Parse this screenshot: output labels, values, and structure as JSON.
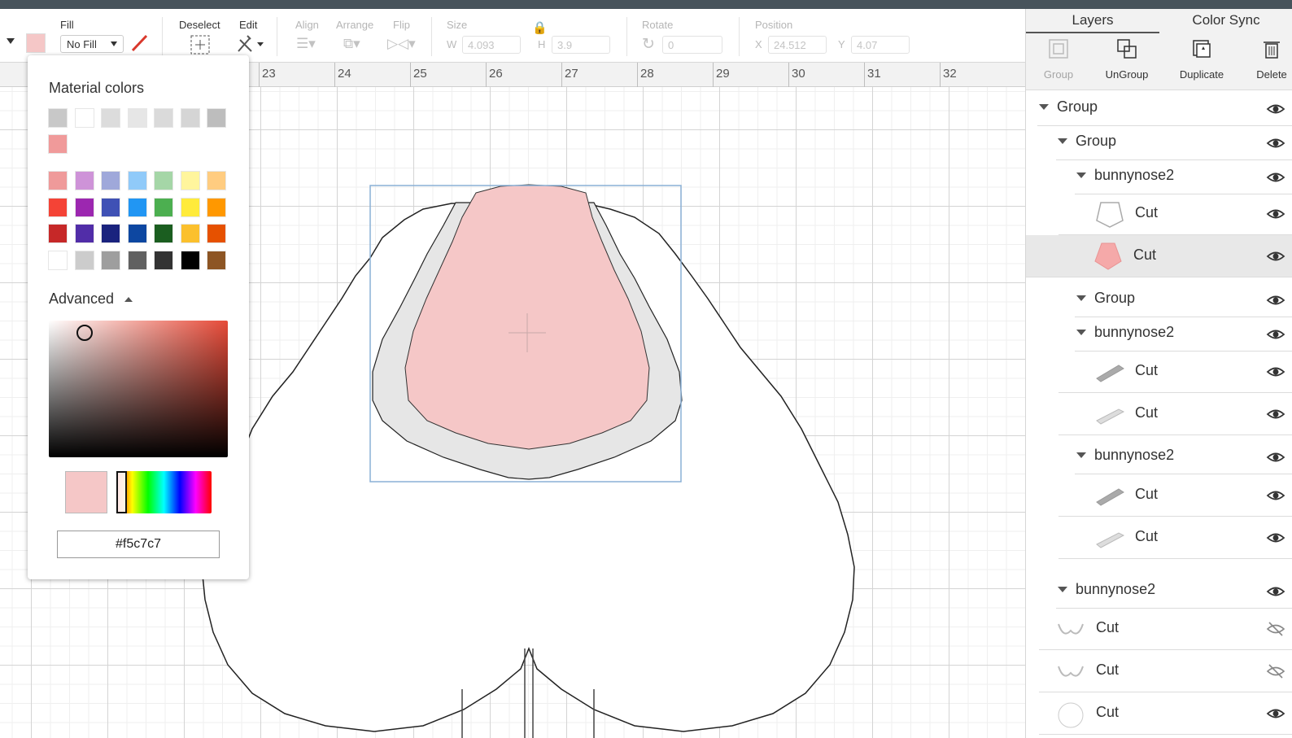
{
  "toolbar": {
    "fill_label": "Fill",
    "fill_value": "No Fill",
    "deselect_label": "Deselect",
    "edit_label": "Edit",
    "align_label": "Align",
    "arrange_label": "Arrange",
    "flip_label": "Flip",
    "size_label": "Size",
    "w_label": "W",
    "w_value": "4.093",
    "h_label": "H",
    "h_value": "3.9",
    "rotate_label": "Rotate",
    "rotate_value": "0",
    "position_label": "Position",
    "x_label": "X",
    "x_value": "24.512",
    "y_label": "Y",
    "y_value": "4.07",
    "swatch_color": "#f5c7c7",
    "stroke_color": "#d9382c"
  },
  "ruler": {
    "numbers": [
      "23",
      "24",
      "25",
      "26",
      "27",
      "28",
      "29",
      "30",
      "31",
      "32"
    ]
  },
  "color_popup": {
    "title": "Material colors",
    "row_grey": [
      "#c8c8c8",
      "#ffffff",
      "#dcdcdc",
      "#e6e6e6",
      "#dadada",
      "#d5d5d5",
      "#bdbdbd"
    ],
    "row_pink": [
      "#f09a9a"
    ],
    "palette": [
      [
        "#ef9a9a",
        "#ce93d8",
        "#9fa8da",
        "#90caf9",
        "#a5d6a7",
        "#fff59d",
        "#ffcc80"
      ],
      [
        "#f44336",
        "#9c27b0",
        "#3f51b5",
        "#2196f3",
        "#4caf50",
        "#ffeb3b",
        "#ff9800"
      ],
      [
        "#c62828",
        "#512da8",
        "#1a237e",
        "#0d47a1",
        "#1b5e20",
        "#fbc02d",
        "#e65100"
      ],
      [
        "#ffffff",
        "#cccccc",
        "#9e9e9e",
        "#616161",
        "#333333",
        "#000000",
        "#8d5524"
      ]
    ],
    "advanced_label": "Advanced",
    "preview_color": "#f5c7c7",
    "hex_value": "#f5c7c7"
  },
  "panel": {
    "tabs": [
      "Layers",
      "Color Sync"
    ],
    "actions": [
      {
        "label": "Group",
        "icon": "group-icon",
        "enabled": false
      },
      {
        "label": "UnGroup",
        "icon": "ungroup-icon",
        "enabled": true
      },
      {
        "label": "Duplicate",
        "icon": "duplicate-icon",
        "enabled": true
      },
      {
        "label": "Delete",
        "icon": "trash-icon",
        "enabled": true
      }
    ],
    "layers": [
      {
        "label": "Group",
        "kind": "group"
      },
      {
        "label": "Group",
        "kind": "group"
      },
      {
        "label": "bunnynose2",
        "kind": "group"
      },
      {
        "label": "Cut",
        "kind": "cut",
        "thumb": "outline-nose"
      },
      {
        "label": "Cut",
        "kind": "cut",
        "thumb": "pink-nose",
        "selected": true
      },
      {
        "label": "Group",
        "kind": "group"
      },
      {
        "label": "bunnynose2",
        "kind": "group"
      },
      {
        "label": "Cut",
        "kind": "cut",
        "thumb": "whisker-dark"
      },
      {
        "label": "Cut",
        "kind": "cut",
        "thumb": "whisker-light"
      },
      {
        "label": "bunnynose2",
        "kind": "group"
      },
      {
        "label": "Cut",
        "kind": "cut",
        "thumb": "whisker-dark"
      },
      {
        "label": "Cut",
        "kind": "cut",
        "thumb": "whisker-light"
      },
      {
        "label": "bunnynose2",
        "kind": "group"
      },
      {
        "label": "Cut",
        "kind": "cut",
        "thumb": "mustache",
        "hidden": true
      },
      {
        "label": "Cut",
        "kind": "cut",
        "thumb": "mustache",
        "hidden": true
      },
      {
        "label": "Cut",
        "kind": "cut",
        "thumb": "blob"
      }
    ]
  }
}
